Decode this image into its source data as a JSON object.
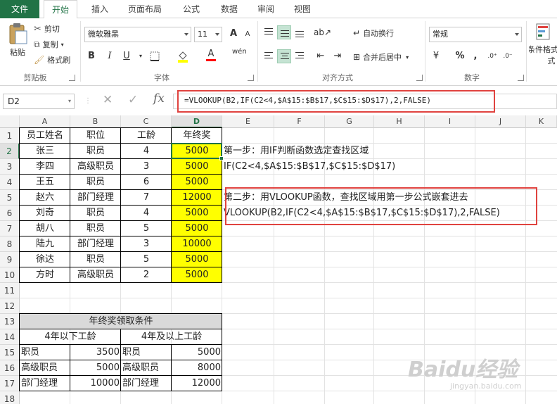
{
  "tabs": [
    "文件",
    "开始",
    "插入",
    "页面布局",
    "公式",
    "数据",
    "审阅",
    "视图"
  ],
  "clipboard": {
    "paste": "粘贴",
    "cut": "剪切",
    "copy": "复制",
    "format_painter": "格式刷",
    "group": "剪贴板"
  },
  "font": {
    "name": "微软雅黑",
    "size": "11",
    "group": "字体",
    "bold": "B",
    "italic": "I",
    "underline": "U",
    "grow": "A",
    "shrink": "A",
    "phonetic": "wén"
  },
  "alignment": {
    "wrap": "自动换行",
    "merge": "合并后居中",
    "group": "对齐方式"
  },
  "number": {
    "format": "常规",
    "percent": "%",
    "comma": ",",
    "group": "数字",
    "currency": "¥"
  },
  "styles": {
    "conditional": "条件格式",
    "sub": "式"
  },
  "formula_bar": {
    "name_box": "D2",
    "formula": "=VLOOKUP(B2,IF(C2<4,$A$15:$B$17,$C$15:$D$17),2,FALSE)",
    "fx": "fx"
  },
  "columns": [
    "A",
    "B",
    "C",
    "D",
    "E",
    "F",
    "G",
    "H",
    "I",
    "J",
    "K"
  ],
  "rows": [
    "1",
    "2",
    "3",
    "4",
    "5",
    "6",
    "7",
    "8",
    "9",
    "10",
    "11",
    "12",
    "13",
    "14",
    "15",
    "16",
    "17",
    "18"
  ],
  "table": {
    "headers": [
      "员工姓名",
      "职位",
      "工龄",
      "年终奖"
    ],
    "rows": [
      [
        "张三",
        "职员",
        "4",
        "5000"
      ],
      [
        "李四",
        "高级职员",
        "3",
        "5000"
      ],
      [
        "王五",
        "职员",
        "6",
        "5000"
      ],
      [
        "赵六",
        "部门经理",
        "7",
        "12000"
      ],
      [
        "刘奇",
        "职员",
        "4",
        "5000"
      ],
      [
        "胡八",
        "职员",
        "5",
        "5000"
      ],
      [
        "陆九",
        "部门经理",
        "3",
        "10000"
      ],
      [
        "徐达",
        "职员",
        "5",
        "5000"
      ],
      [
        "方时",
        "高级职员",
        "2",
        "5000"
      ]
    ]
  },
  "notes": {
    "step1_title": "第一步：用IF判断函数选定查找区域",
    "step1_formula": "IF(C2<4,$A$15:$B$17,$C$15:$D$17)",
    "step2_title": "第二步：用VLOOKUP函数，查找区域用第一步公式嵌套进去",
    "step2_formula": "VLOOKUP(B2,IF(C2<4,$A$15:$B$17,$C$15:$D$17),2,FALSE)"
  },
  "conditions": {
    "title": "年终奖领取条件",
    "left_header": "4年以下工龄",
    "right_header": "4年及以上工龄",
    "left": [
      [
        "职员",
        "3500"
      ],
      [
        "高级职员",
        "5000"
      ],
      [
        "部门经理",
        "10000"
      ]
    ],
    "right": [
      [
        "职员",
        "5000"
      ],
      [
        "高级职员",
        "8000"
      ],
      [
        "部门经理",
        "12000"
      ]
    ]
  },
  "watermark": {
    "brand": "Baidu经验",
    "url": "jingyan.baidu.com"
  },
  "colors": {
    "excel_green": "#217346",
    "highlight_red": "#e0433f",
    "yellow": "#ffff00"
  }
}
